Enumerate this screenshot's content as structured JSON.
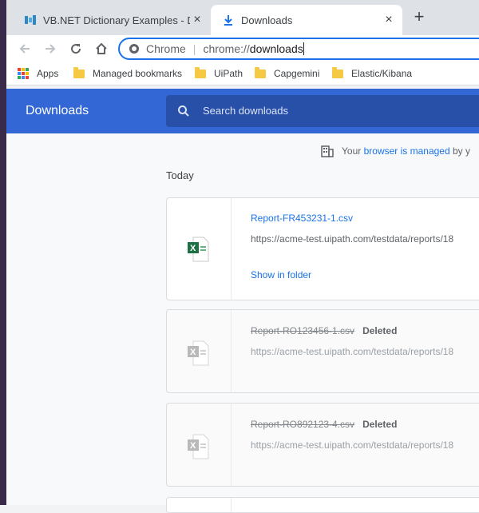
{
  "tabs": [
    {
      "title": "VB.NET Dictionary Examples - Do",
      "close": "×"
    },
    {
      "title": "Downloads",
      "close": "×"
    }
  ],
  "new_tab": "+",
  "omnibox": {
    "chip": "Chrome",
    "separator": "|",
    "scheme": "chrome://",
    "path": "downloads"
  },
  "bookmarks": [
    {
      "label": "Apps",
      "icon": "apps-grid-icon"
    },
    {
      "label": "Managed bookmarks",
      "icon": "folder-icon"
    },
    {
      "label": "UiPath",
      "icon": "folder-icon"
    },
    {
      "label": "Capgemini",
      "icon": "folder-icon"
    },
    {
      "label": "Elastic/Kibana",
      "icon": "folder-icon"
    }
  ],
  "page": {
    "heading": "Downloads",
    "search_placeholder": "Search downloads",
    "managed_prefix": "Your ",
    "managed_link": "browser is managed",
    "managed_suffix": " by y",
    "section_label": "Today"
  },
  "downloads": [
    {
      "filename": "Report-FR453231-1.csv",
      "url": "https://acme-test.uipath.com/testdata/reports/18",
      "action": "Show in folder",
      "status": ""
    },
    {
      "filename": "Report-RO123456-1.csv",
      "url": "https://acme-test.uipath.com/testdata/reports/18",
      "status": "Deleted"
    },
    {
      "filename": "Report-RO892123-4.csv",
      "url": "https://acme-test.uipath.com/testdata/reports/18",
      "status": "Deleted"
    }
  ],
  "colors": {
    "accent": "#1a73e8",
    "header": "#3367d6",
    "excel_green": "#1d7044"
  }
}
